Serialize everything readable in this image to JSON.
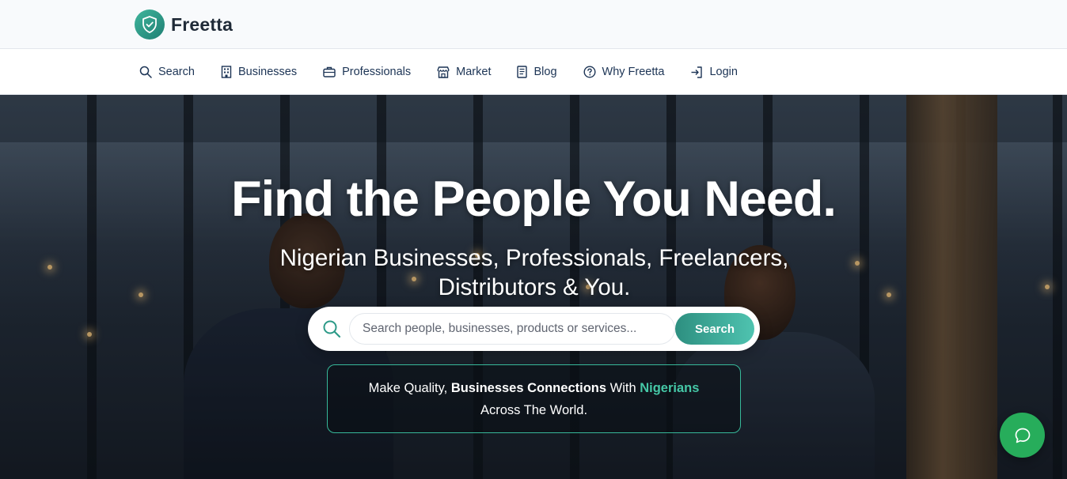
{
  "brand": {
    "name": "Freetta",
    "logo_icon": "shield-check-icon",
    "accent": "#2d8f80"
  },
  "nav": {
    "items": [
      {
        "label": "Search",
        "icon": "search-icon"
      },
      {
        "label": "Businesses",
        "icon": "building-icon"
      },
      {
        "label": "Professionals",
        "icon": "briefcase-icon"
      },
      {
        "label": "Market",
        "icon": "store-icon"
      },
      {
        "label": "Blog",
        "icon": "document-icon"
      },
      {
        "label": "Why Freetta",
        "icon": "help-circle-icon"
      },
      {
        "label": "Login",
        "icon": "login-icon"
      }
    ]
  },
  "hero": {
    "title": "Find the People You Need.",
    "subtitle": "Nigerian Businesses, Professionals, Freelancers, Distributors & You.",
    "search": {
      "placeholder": "Search people, businesses, products or services...",
      "value": "",
      "button_label": "Search"
    },
    "tagline": {
      "part1": "Make Quality, ",
      "bold": "Businesses Connections",
      "part2": " With ",
      "accent": "Nigerians",
      "part3": "Across The World."
    }
  },
  "chat": {
    "icon": "chat-bubble-icon",
    "color": "#27ad5b"
  }
}
